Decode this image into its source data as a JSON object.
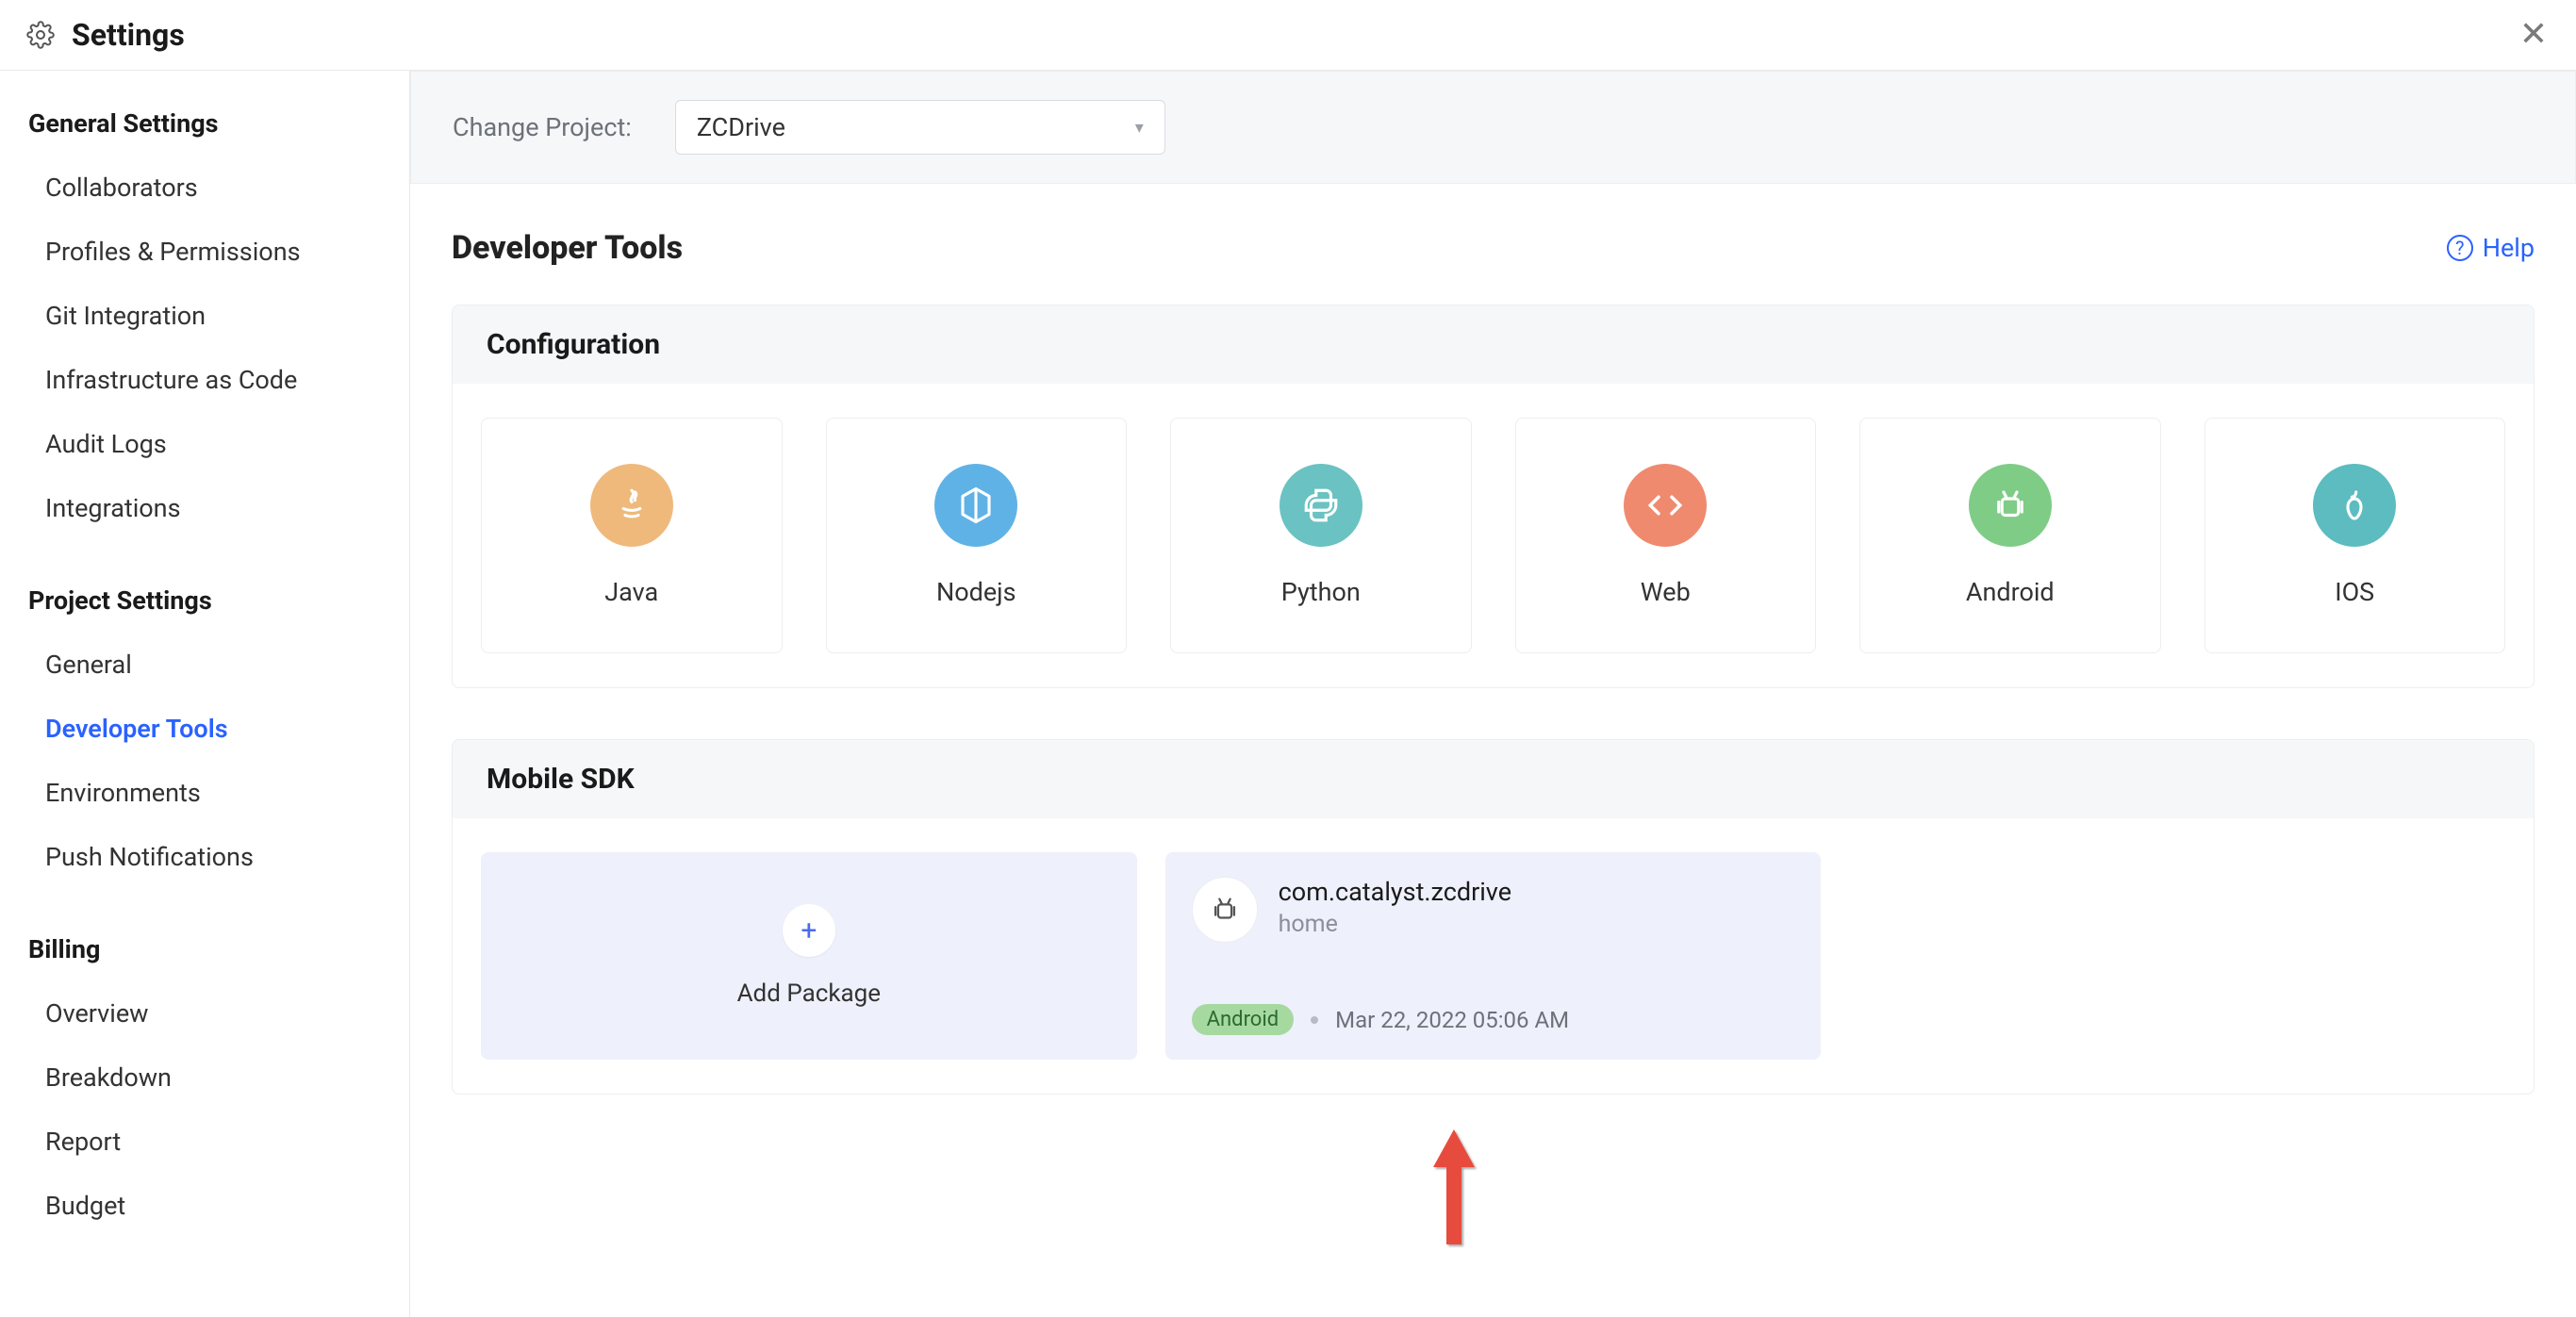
{
  "header": {
    "title": "Settings"
  },
  "sidebar": {
    "general": {
      "heading": "General Settings",
      "items": [
        "Collaborators",
        "Profiles & Permissions",
        "Git Integration",
        "Infrastructure as Code",
        "Audit Logs",
        "Integrations"
      ]
    },
    "project": {
      "heading": "Project Settings",
      "items": [
        "General",
        "Developer Tools",
        "Environments",
        "Push Notifications"
      ],
      "activeIndex": 1
    },
    "billing": {
      "heading": "Billing",
      "items": [
        "Overview",
        "Breakdown",
        "Report",
        "Budget"
      ]
    }
  },
  "projectBar": {
    "label": "Change Project:",
    "selected": "ZCDrive"
  },
  "page": {
    "title": "Developer Tools",
    "helpLabel": "Help"
  },
  "configuration": {
    "heading": "Configuration",
    "cards": [
      {
        "id": "java",
        "label": "Java"
      },
      {
        "id": "node",
        "label": "Nodejs"
      },
      {
        "id": "python",
        "label": "Python"
      },
      {
        "id": "web",
        "label": "Web"
      },
      {
        "id": "android",
        "label": "Android"
      },
      {
        "id": "ios",
        "label": "IOS"
      }
    ]
  },
  "mobileSdk": {
    "heading": "Mobile SDK",
    "addLabel": "Add Package",
    "package": {
      "name": "com.catalyst.zcdrive",
      "subtitle": "home",
      "platformBadge": "Android",
      "timestamp": "Mar 22, 2022 05:06 AM"
    }
  }
}
